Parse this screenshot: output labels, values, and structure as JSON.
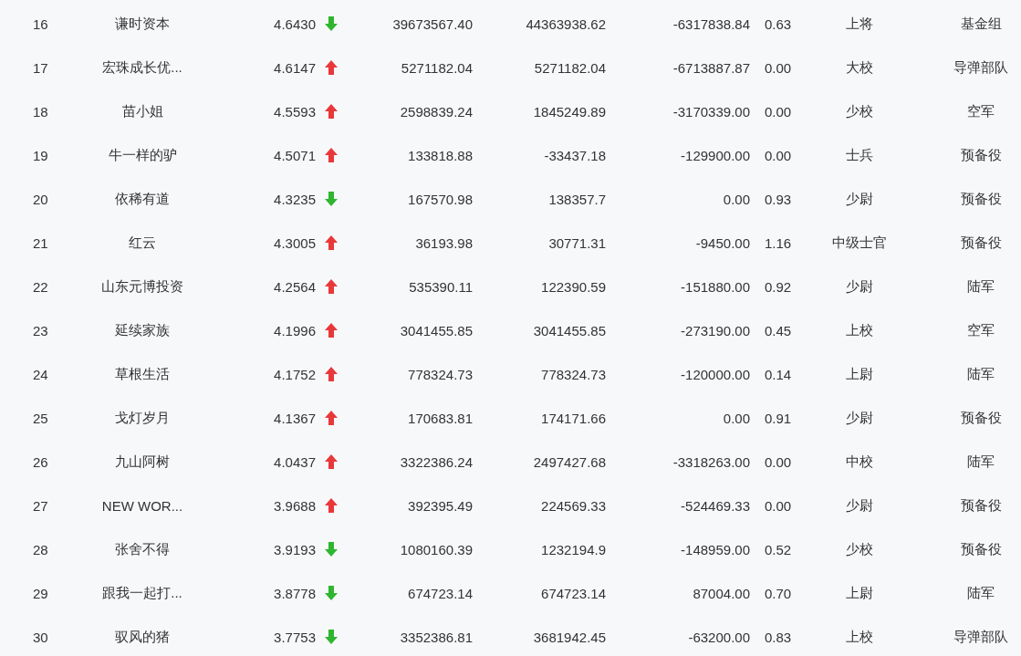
{
  "table": {
    "rows": [
      {
        "rank": "16",
        "name": "谦时资本",
        "value": "4.6430",
        "rising": false,
        "column_4": "39673567.40",
        "column_5": "44363938.62",
        "column_6": "-6317838.84",
        "column_7": "0.63",
        "grade": "上将",
        "branch": "基金组"
      },
      {
        "rank": "17",
        "name": "宏珠成长优...",
        "value": "4.6147",
        "rising": true,
        "column_4": "5271182.04",
        "column_5": "5271182.04",
        "column_6": "-6713887.87",
        "column_7": "0.00",
        "grade": "大校",
        "branch": "导弹部队"
      },
      {
        "rank": "18",
        "name": "苗小姐",
        "value": "4.5593",
        "rising": true,
        "column_4": "2598839.24",
        "column_5": "1845249.89",
        "column_6": "-3170339.00",
        "column_7": "0.00",
        "grade": "少校",
        "branch": "空军"
      },
      {
        "rank": "19",
        "name": "牛一样的驴",
        "value": "4.5071",
        "rising": true,
        "column_4": "133818.88",
        "column_5": "-33437.18",
        "column_6": "-129900.00",
        "column_7": "0.00",
        "grade": "士兵",
        "branch": "预备役"
      },
      {
        "rank": "20",
        "name": "依稀有道",
        "value": "4.3235",
        "rising": false,
        "column_4": "167570.98",
        "column_5": "138357.7",
        "column_6": "0.00",
        "column_7": "0.93",
        "grade": "少尉",
        "branch": "预备役"
      },
      {
        "rank": "21",
        "name": "红云",
        "value": "4.3005",
        "rising": true,
        "column_4": "36193.98",
        "column_5": "30771.31",
        "column_6": "-9450.00",
        "column_7": "1.16",
        "grade": "中级士官",
        "branch": "预备役"
      },
      {
        "rank": "22",
        "name": "山东元博投资",
        "value": "4.2564",
        "rising": true,
        "column_4": "535390.11",
        "column_5": "122390.59",
        "column_6": "-151880.00",
        "column_7": "0.92",
        "grade": "少尉",
        "branch": "陆军"
      },
      {
        "rank": "23",
        "name": "延续家族",
        "value": "4.1996",
        "rising": true,
        "column_4": "3041455.85",
        "column_5": "3041455.85",
        "column_6": "-273190.00",
        "column_7": "0.45",
        "grade": "上校",
        "branch": "空军"
      },
      {
        "rank": "24",
        "name": "草根生活",
        "value": "4.1752",
        "rising": true,
        "column_4": "778324.73",
        "column_5": "778324.73",
        "column_6": "-120000.00",
        "column_7": "0.14",
        "grade": "上尉",
        "branch": "陆军"
      },
      {
        "rank": "25",
        "name": "戈灯岁月",
        "value": "4.1367",
        "rising": true,
        "column_4": "170683.81",
        "column_5": "174171.66",
        "column_6": "0.00",
        "column_7": "0.91",
        "grade": "少尉",
        "branch": "预备役"
      },
      {
        "rank": "26",
        "name": "九山阿树",
        "value": "4.0437",
        "rising": true,
        "column_4": "3322386.24",
        "column_5": "2497427.68",
        "column_6": "-3318263.00",
        "column_7": "0.00",
        "grade": "中校",
        "branch": "陆军"
      },
      {
        "rank": "27",
        "name": "NEW WOR...",
        "value": "3.9688",
        "rising": true,
        "column_4": "392395.49",
        "column_5": "224569.33",
        "column_6": "-524469.33",
        "column_7": "0.00",
        "grade": "少尉",
        "branch": "预备役"
      },
      {
        "rank": "28",
        "name": "张舍不得",
        "value": "3.9193",
        "rising": false,
        "column_4": "1080160.39",
        "column_5": "1232194.9",
        "column_6": "-148959.00",
        "column_7": "0.52",
        "grade": "少校",
        "branch": "预备役"
      },
      {
        "rank": "29",
        "name": "跟我一起打...",
        "value": "3.8778",
        "rising": false,
        "column_4": "674723.14",
        "column_5": "674723.14",
        "column_6": "87004.00",
        "column_7": "0.70",
        "grade": "上尉",
        "branch": "陆军"
      },
      {
        "rank": "30",
        "name": "驭风的猪",
        "value": "3.7753",
        "rising": false,
        "column_4": "3352386.81",
        "column_5": "3681942.45",
        "column_6": "-63200.00",
        "column_7": "0.83",
        "grade": "上校",
        "branch": "导弹部队"
      }
    ]
  }
}
